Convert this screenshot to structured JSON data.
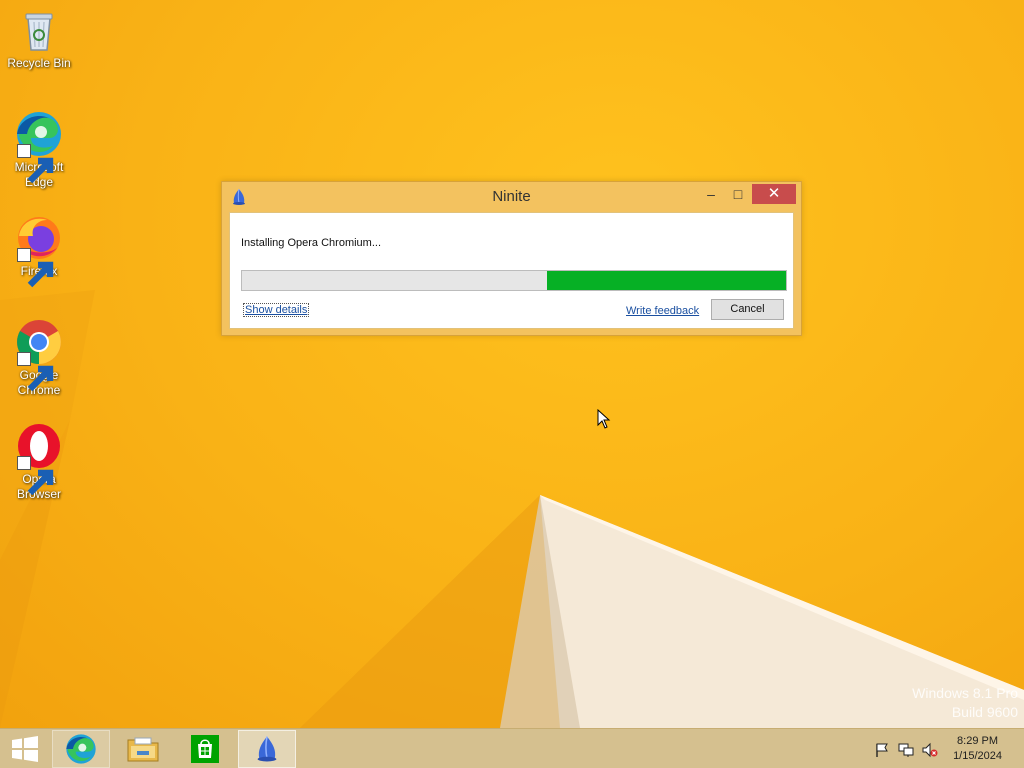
{
  "desktop": {
    "icons": [
      {
        "label": "Recycle Bin",
        "icon": "recycle-bin-icon"
      },
      {
        "label": "Microsoft Edge",
        "icon": "edge-icon"
      },
      {
        "label": "Firefox",
        "icon": "firefox-icon"
      },
      {
        "label": "Google Chrome",
        "icon": "chrome-icon"
      },
      {
        "label": "Opera Browser",
        "icon": "opera-icon"
      }
    ],
    "watermark": {
      "line1": "Windows 8.1 Pro",
      "line2": "Build 9600"
    }
  },
  "ninite_window": {
    "title": "Ninite",
    "minimize_glyph": "–",
    "maximize_glyph": "□",
    "close_glyph": "✕",
    "status": "Installing Opera Chromium...",
    "progress": 0.44,
    "show_details": "Show details",
    "write_feedback": "Write feedback",
    "cancel": "Cancel"
  },
  "taskbar": {
    "apps": [
      {
        "name": "Microsoft Edge",
        "icon": "edge-icon"
      },
      {
        "name": "File Explorer",
        "icon": "folder-icon"
      },
      {
        "name": "Store",
        "icon": "store-icon"
      },
      {
        "name": "Ninite",
        "icon": "ninite-icon"
      }
    ],
    "tray": {
      "icons": [
        "flag-icon",
        "network-icon",
        "volume-muted-icon"
      ]
    },
    "clock": {
      "time": "8:29 PM",
      "date": "1/15/2024"
    }
  },
  "colors": {
    "wallpaper": "#f9b71a",
    "window_frame": "#f3c25f",
    "close_button": "#c84c4c",
    "progress_fill": "#06b025",
    "taskbar": "#d5c08f",
    "link": "#1a4fa0"
  }
}
